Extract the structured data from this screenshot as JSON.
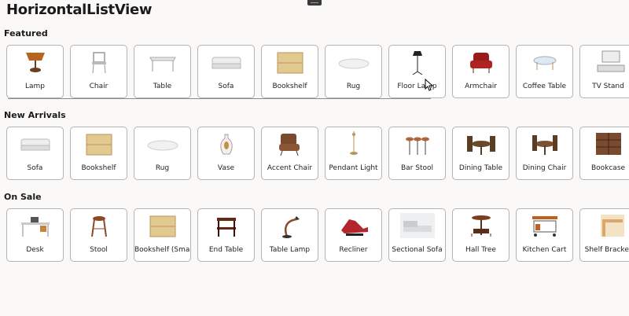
{
  "app": {
    "title": "HorizontalListView"
  },
  "sections": [
    {
      "title": "Featured",
      "items": [
        {
          "label": "Lamp",
          "icon": "lamp-icon"
        },
        {
          "label": "Chair",
          "icon": "chair-icon"
        },
        {
          "label": "Table",
          "icon": "table-icon"
        },
        {
          "label": "Sofa",
          "icon": "sofa-icon"
        },
        {
          "label": "Bookshelf",
          "icon": "bookshelf-icon"
        },
        {
          "label": "Rug",
          "icon": "rug-icon"
        },
        {
          "label": "Floor Lamp",
          "icon": "floor-lamp-icon"
        },
        {
          "label": "Armchair",
          "icon": "armchair-icon"
        },
        {
          "label": "Coffee Table",
          "icon": "coffee-table-icon"
        },
        {
          "label": "TV Stand",
          "icon": "tv-stand-icon"
        }
      ]
    },
    {
      "title": "New Arrivals",
      "items": [
        {
          "label": "Sofa",
          "icon": "sofa-icon"
        },
        {
          "label": "Bookshelf",
          "icon": "bookshelf-icon"
        },
        {
          "label": "Rug",
          "icon": "rug-icon"
        },
        {
          "label": "Vase",
          "icon": "vase-icon"
        },
        {
          "label": "Accent Chair",
          "icon": "accent-chair-icon"
        },
        {
          "label": "Pendant Light",
          "icon": "pendant-light-icon"
        },
        {
          "label": "Bar Stool",
          "icon": "bar-stool-icon"
        },
        {
          "label": "Dining Table",
          "icon": "dining-table-icon"
        },
        {
          "label": "Dining Chair",
          "icon": "dining-chair-icon"
        },
        {
          "label": "Bookcase",
          "icon": "bookcase-icon"
        }
      ]
    },
    {
      "title": "On Sale",
      "items": [
        {
          "label": "Desk",
          "icon": "desk-icon"
        },
        {
          "label": "Stool",
          "icon": "stool-icon"
        },
        {
          "label": "Bookshelf (Sma…",
          "icon": "bookshelf-icon"
        },
        {
          "label": "End Table",
          "icon": "end-table-icon"
        },
        {
          "label": "Table Lamp",
          "icon": "table-lamp-icon"
        },
        {
          "label": "Recliner",
          "icon": "recliner-icon"
        },
        {
          "label": "Sectional Sofa",
          "icon": "sectional-sofa-icon"
        },
        {
          "label": "Hall Tree",
          "icon": "hall-tree-icon"
        },
        {
          "label": "Kitchen Cart",
          "icon": "kitchen-cart-icon"
        },
        {
          "label": "Shelf Bracket",
          "icon": "shelf-bracket-icon"
        }
      ]
    }
  ]
}
